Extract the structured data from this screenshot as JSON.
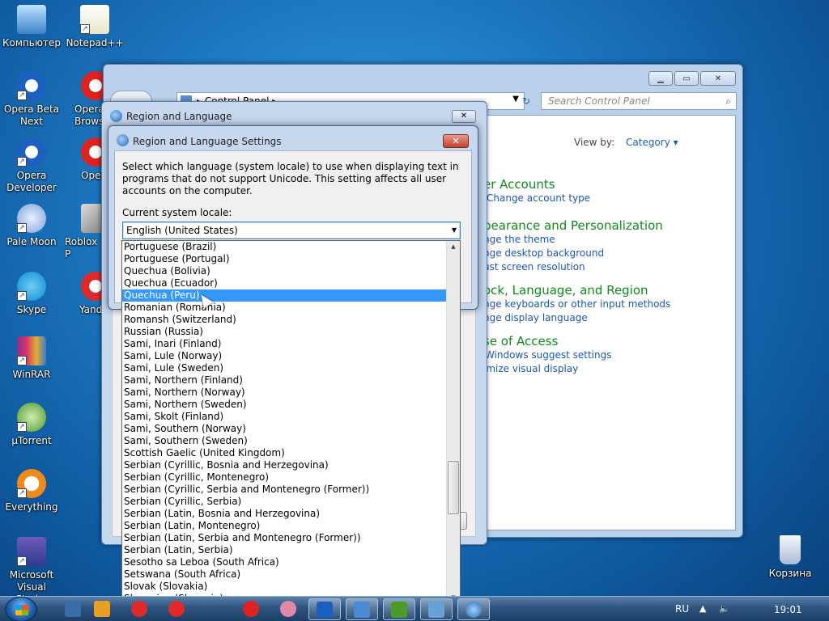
{
  "desktop": {
    "icons": [
      {
        "label": "Компьютер"
      },
      {
        "label": "Notepad++"
      },
      {
        "label": "Opera Beta Next"
      },
      {
        "label": "Opera Developer"
      },
      {
        "label": "Pale Moon"
      },
      {
        "label": "Skype"
      },
      {
        "label": "WinRAR"
      },
      {
        "label": "µTorrent"
      },
      {
        "label": "Everything"
      },
      {
        "label": "Microsoft Visual Stud..."
      },
      {
        "label": "Корзина"
      }
    ],
    "partial_icons": [
      {
        "label": "Opera Brows"
      },
      {
        "label": "Opera"
      },
      {
        "label": "Roblox P"
      },
      {
        "label": "Yand"
      }
    ]
  },
  "control_panel": {
    "address": "Control Panel",
    "search_placeholder": "Search Control Panel",
    "view_by_label": "View by:",
    "view_by_value": "Category",
    "sections": [
      {
        "heading": "er Accounts",
        "links": [
          "Change account type"
        ]
      },
      {
        "heading": "pearance and Personalization",
        "links": [
          "nge the theme",
          "nge desktop background",
          "ust screen resolution"
        ]
      },
      {
        "heading": "ock, Language, and Region",
        "links": [
          "nge keyboards or other input methods",
          "nge display language"
        ]
      },
      {
        "heading": "se of Access",
        "links": [
          "Windows suggest settings",
          "imize visual display"
        ]
      }
    ]
  },
  "region_language": {
    "title": "Region and Language"
  },
  "region_language_settings": {
    "title": "Region and Language Settings",
    "description": "Select which language (system locale) to use when displaying text in programs that do not support Unicode. This setting affects all user accounts on the computer.",
    "current_label": "Current system locale:",
    "current_value": "English (United States)",
    "options": [
      "Portuguese (Brazil)",
      "Portuguese (Portugal)",
      "Quechua (Bolivia)",
      "Quechua (Ecuador)",
      "Quechua (Peru)",
      "Romanian (Romania)",
      "Romansh (Switzerland)",
      "Russian (Russia)",
      "Sami, Inari (Finland)",
      "Sami, Lule (Norway)",
      "Sami, Lule (Sweden)",
      "Sami, Northern (Finland)",
      "Sami, Northern (Norway)",
      "Sami, Northern (Sweden)",
      "Sami, Skolt (Finland)",
      "Sami, Southern (Norway)",
      "Sami, Southern (Sweden)",
      "Scottish Gaelic (United Kingdom)",
      "Serbian (Cyrillic, Bosnia and Herzegovina)",
      "Serbian (Cyrillic, Montenegro)",
      "Serbian (Cyrillic, Serbia and Montenegro (Former))",
      "Serbian (Cyrillic, Serbia)",
      "Serbian (Latin, Bosnia and Herzegovina)",
      "Serbian (Latin, Montenegro)",
      "Serbian (Latin, Serbia and Montenegro (Former))",
      "Serbian (Latin, Serbia)",
      "Sesotho sa Leboa (South Africa)",
      "Setswana (South Africa)",
      "Slovak (Slovakia)",
      "Slovenian (Slovenia)"
    ],
    "selected_option": "Quechua (Peru)"
  },
  "taskbar": {
    "language": "RU",
    "clock": "19:01"
  },
  "colors": {
    "selection": "#3399ff",
    "link": "#1c56b8",
    "heading": "#0e8a1e",
    "close_button": "#c0412c"
  }
}
